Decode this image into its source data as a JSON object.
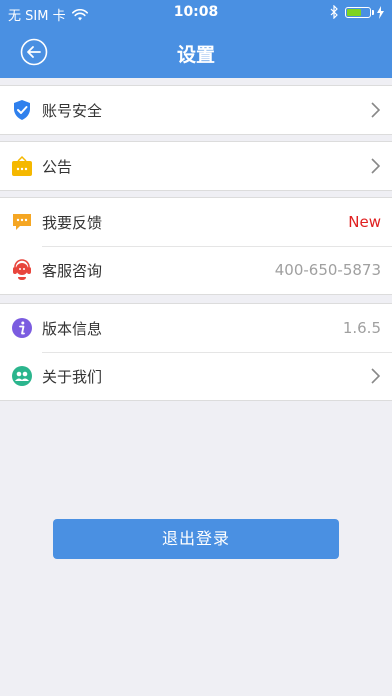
{
  "status_bar": {
    "carrier": "无 SIM 卡",
    "time": "10:08",
    "battery_level": 0.6,
    "icons": [
      "wifi-icon",
      "bluetooth-icon",
      "battery-icon",
      "charging-icon"
    ]
  },
  "nav": {
    "title": "设置",
    "back_icon": "back-arrow-circle-icon"
  },
  "groups": [
    {
      "items": [
        {
          "label": "账号安全",
          "icon": "shield-check-icon",
          "icon_color": "#2f80ed",
          "accessory": "chevron"
        }
      ]
    },
    {
      "items": [
        {
          "label": "公告",
          "icon": "announcement-board-icon",
          "icon_color": "#f5b800",
          "accessory": "chevron"
        }
      ]
    },
    {
      "items": [
        {
          "label": "我要反馈",
          "icon": "chat-bubble-icon",
          "icon_color": "#f5a623",
          "value": "New",
          "value_color": "#e02020"
        },
        {
          "label": "客服咨询",
          "icon": "customer-service-headset-icon",
          "icon_color": "#e8453c",
          "value": "400-650-5873"
        }
      ]
    },
    {
      "items": [
        {
          "label": "版本信息",
          "icon": "info-icon",
          "icon_color": "#7b5ce0",
          "value": "1.6.5"
        },
        {
          "label": "关于我们",
          "icon": "people-icon",
          "icon_color": "#2bb58d",
          "accessory": "chevron"
        }
      ]
    }
  ],
  "logout_button": {
    "label": "退出登录"
  },
  "colors": {
    "primary": "#4a90e2",
    "background": "#efeff4",
    "new_badge": "#e02020"
  }
}
